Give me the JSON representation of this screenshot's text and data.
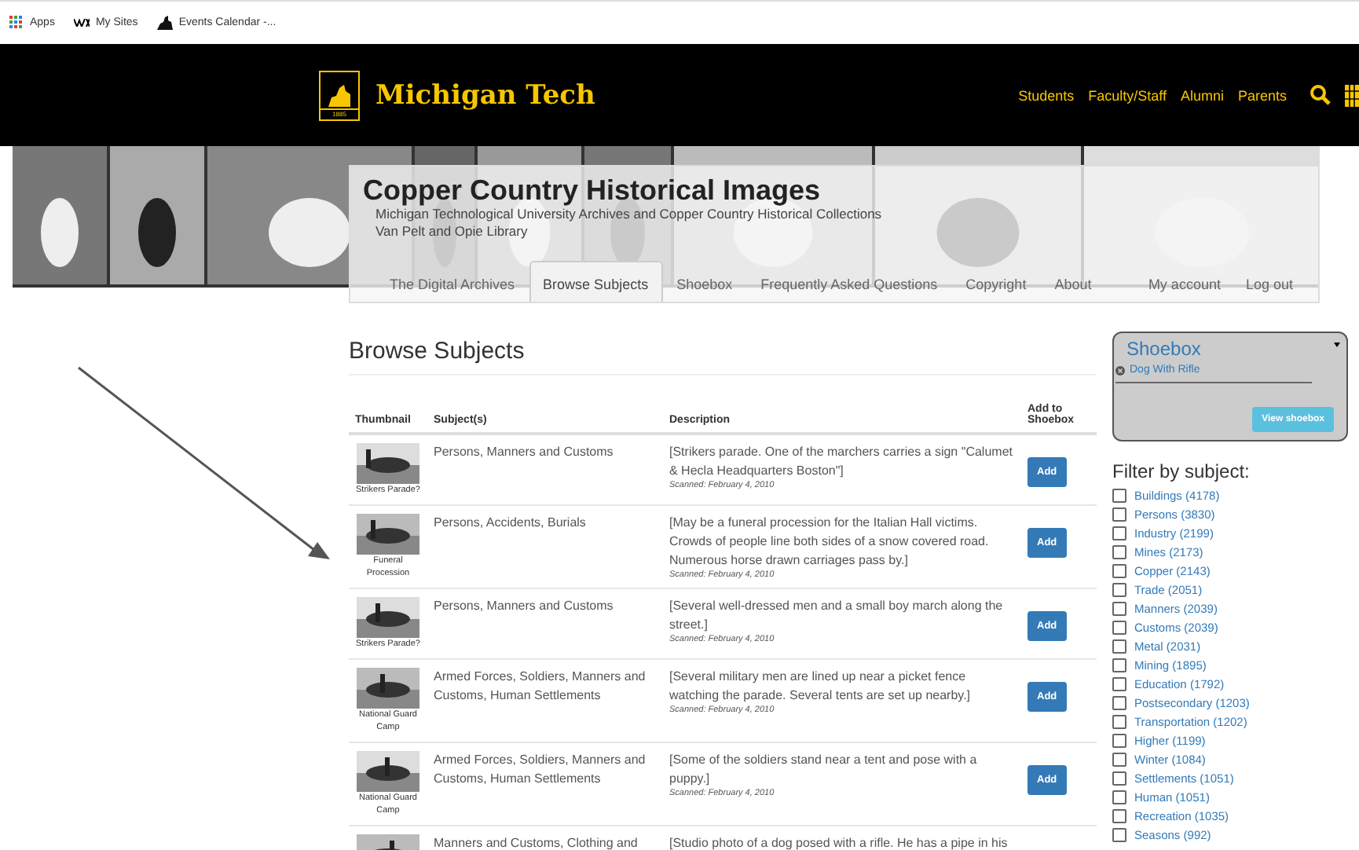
{
  "bookmarks": [
    {
      "kind": "apps",
      "label": "Apps"
    },
    {
      "kind": "wix",
      "label": "My Sites"
    },
    {
      "kind": "figure",
      "label": "Events Calendar -..."
    }
  ],
  "header": {
    "logo_year": "1885",
    "logo_text": "Michigan Tech",
    "nav": [
      "Students",
      "Faculty/Staff",
      "Alumni",
      "Parents"
    ]
  },
  "banner": {
    "title": "Copper Country Historical Images",
    "subtitle": "Michigan Technological University Archives and Copper Country Historical Collections",
    "library": "Van Pelt and Opie Library",
    "tabs": [
      {
        "label": "The Digital Archives",
        "selected": false
      },
      {
        "label": "Browse Subjects",
        "selected": true
      },
      {
        "label": "Shoebox",
        "selected": false
      },
      {
        "label": "Frequently Asked Questions",
        "selected": false
      },
      {
        "label": "Copyright",
        "selected": false
      },
      {
        "label": "About",
        "selected": false
      }
    ],
    "account_links": [
      "My account",
      "Log out"
    ]
  },
  "heading": "Browse Subjects",
  "table": {
    "columns": [
      "Thumbnail",
      "Subject(s)",
      "Description",
      "Add to Shoebox"
    ],
    "rows": [
      {
        "caption": "Strikers Parade?",
        "subjects": "Persons, Manners and Customs",
        "description": "[Strikers parade. One of the marchers carries a sign \"Calumet & Hecla Headquarters Boston\"]",
        "scanned": "Scanned: February 4, 2010",
        "button": "Add"
      },
      {
        "caption": "Funeral Procession",
        "subjects": "Persons, Accidents, Burials",
        "description": "[May be a funeral procession for the Italian Hall victims. Crowds of people line both sides of a snow covered road. Numerous horse drawn carriages pass by.]",
        "scanned": "Scanned: February 4, 2010",
        "button": "Add"
      },
      {
        "caption": "Strikers Parade?",
        "subjects": "Persons, Manners and Customs",
        "description": "[Several well-dressed men and a small boy march along the street.]",
        "scanned": "Scanned: February 4, 2010",
        "button": "Add"
      },
      {
        "caption": "National Guard Camp",
        "subjects": "Armed Forces, Soldiers, Manners and Customs, Human Settlements",
        "description": "[Several military men are lined up near a picket fence watching the parade. Several tents are set up nearby.]",
        "scanned": "Scanned: February 4, 2010",
        "button": "Add"
      },
      {
        "caption": "National Guard Camp",
        "subjects": "Armed Forces, Soldiers, Manners and Customs, Human Settlements",
        "description": "[Some of the soldiers stand near a tent and pose with a puppy.]",
        "scanned": "Scanned: February 4, 2010",
        "button": "Add"
      },
      {
        "subjects": "Manners and Customs, Clothing and",
        "description": "[Studio photo of a dog posed with a rifle. He has a pipe in his"
      }
    ]
  },
  "shoebox": {
    "title": "Shoebox",
    "items": [
      "Dog With Rifle"
    ],
    "button": "View shoebox"
  },
  "filter": {
    "title": "Filter by subject:",
    "items": [
      {
        "label": "Buildings (4178)",
        "checked": false
      },
      {
        "label": "Persons (3830)",
        "checked": false
      },
      {
        "label": "Industry (2199)",
        "checked": false
      },
      {
        "label": "Mines (2173)",
        "checked": false
      },
      {
        "label": "Copper (2143)",
        "checked": false
      },
      {
        "label": "Trade (2051)",
        "checked": false
      },
      {
        "label": "Manners (2039)",
        "checked": false
      },
      {
        "label": "Customs (2039)",
        "checked": false
      },
      {
        "label": "Metal (2031)",
        "checked": false
      },
      {
        "label": "Mining (1895)",
        "checked": false
      },
      {
        "label": "Education (1792)",
        "checked": false
      },
      {
        "label": "Postsecondary (1203)",
        "checked": false
      },
      {
        "label": "Transportation (1202)",
        "checked": false
      },
      {
        "label": "Higher (1199)",
        "checked": false
      },
      {
        "label": "Winter (1084)",
        "checked": false
      },
      {
        "label": "Settlements (1051)",
        "checked": false
      },
      {
        "label": "Human (1051)",
        "checked": false
      },
      {
        "label": "Recreation (1035)",
        "checked": false
      },
      {
        "label": "Seasons (992)",
        "checked": false
      }
    ]
  }
}
